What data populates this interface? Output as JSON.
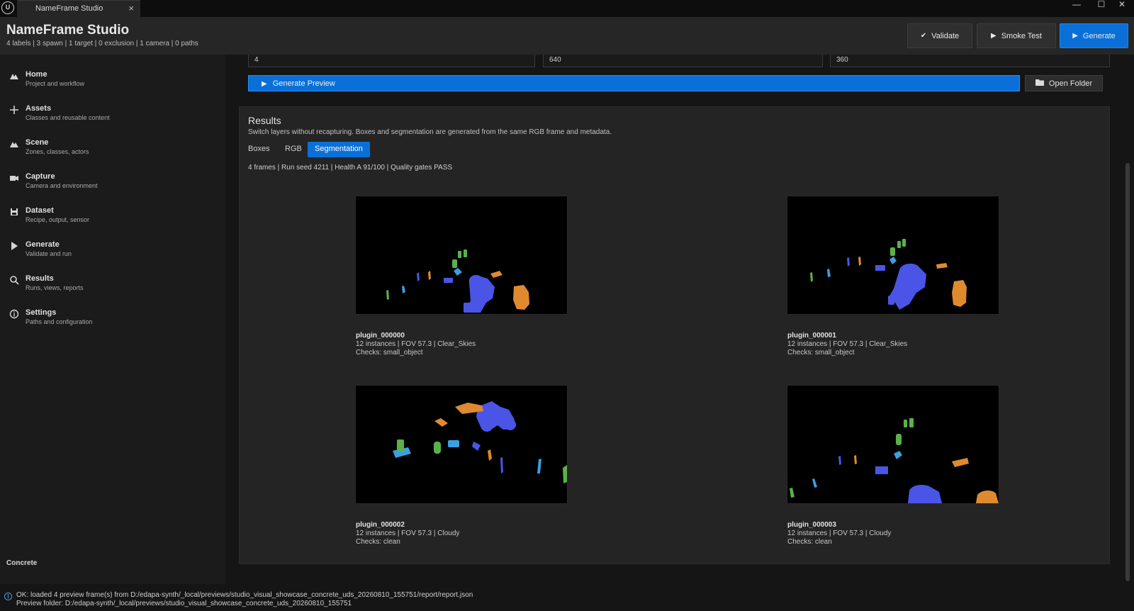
{
  "window": {
    "tab_title": "NameFrame Studio",
    "tab_close": "×",
    "minimize": "—",
    "maximize": "☐",
    "close": "✕"
  },
  "header": {
    "title": "NameFrame Studio",
    "stats": "4 labels  |  3 spawn  |  1 target  |  0 exclusion  |  1 camera  |  0 paths",
    "validate_label": "Validate",
    "smoke_test_label": "Smoke Test",
    "generate_label": "Generate"
  },
  "sidebar": {
    "items": [
      {
        "label": "Home",
        "sub": "Project and workflow",
        "icon": "mountain-icon"
      },
      {
        "label": "Assets",
        "sub": "Classes and reusable content",
        "icon": "plus-icon"
      },
      {
        "label": "Scene",
        "sub": "Zones, classes, actors",
        "icon": "mountain-icon"
      },
      {
        "label": "Capture",
        "sub": "Camera and environment",
        "icon": "camera-icon"
      },
      {
        "label": "Dataset",
        "sub": "Recipe, output, sensor",
        "icon": "save-icon"
      },
      {
        "label": "Generate",
        "sub": "Validate and run",
        "icon": "play-icon"
      },
      {
        "label": "Results",
        "sub": "Runs, views, reports",
        "icon": "search-icon"
      },
      {
        "label": "Settings",
        "sub": "Paths and configuration",
        "icon": "info-icon"
      }
    ],
    "theme": "Concrete"
  },
  "preview": {
    "fields": [
      "4",
      "640",
      "360"
    ],
    "generate_preview_label": "Generate Preview",
    "open_folder_label": "Open Folder"
  },
  "results": {
    "title": "Results",
    "description": "Switch layers without recapturing. Boxes and segmentation are generated from the same RGB frame and metadata.",
    "tabs": [
      "Boxes",
      "RGB",
      "Segmentation"
    ],
    "active_tab": "Segmentation",
    "summary": "4 frames  |  Run seed 4211  |  Health A 91/100  |  Quality gates PASS",
    "frames": [
      {
        "name": "plugin_000000",
        "meta": "12 instances  |  FOV 57.3  |  Clear_Skies",
        "checks": "Checks: small_object"
      },
      {
        "name": "plugin_000001",
        "meta": "12 instances  |  FOV 57.3  |  Clear_Skies",
        "checks": "Checks: small_object"
      },
      {
        "name": "plugin_000002",
        "meta": "12 instances  |  FOV 57.3  |  Cloudy",
        "checks": "Checks: clean"
      },
      {
        "name": "plugin_000003",
        "meta": "12 instances  |  FOV 57.3  |  Cloudy",
        "checks": "Checks: clean"
      }
    ]
  },
  "status": {
    "line1": "OK: loaded 4 preview frame(s) from D:/edapa-synth/_local/previews/studio_visual_showcase_concrete_uds_20260810_155751/report/report.json",
    "line2": "Preview folder: D:/edapa-synth/_local/previews/studio_visual_showcase_concrete_uds_20260810_155751"
  },
  "colors": {
    "accent": "#0a70d8",
    "seg_blue": "#4a55e6",
    "seg_orange": "#e08a30",
    "seg_green": "#5cb04a",
    "seg_cyan": "#3aa0e0"
  }
}
